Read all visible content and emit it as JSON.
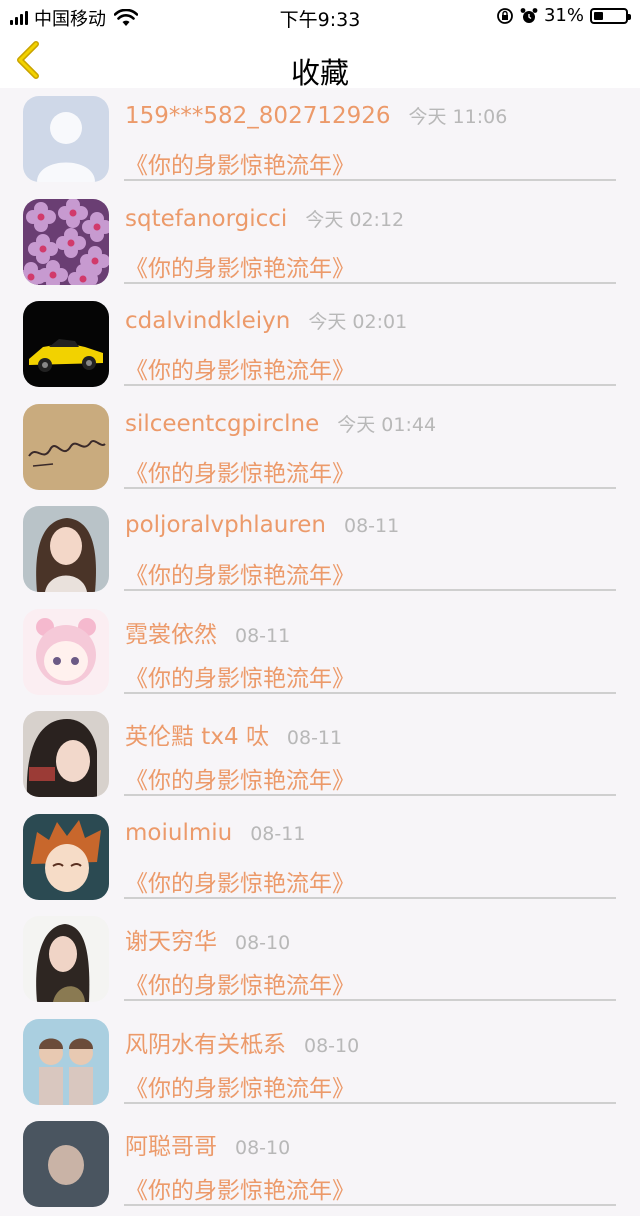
{
  "status_bar": {
    "carrier": "中国移动",
    "time": "下午9:33",
    "battery": "31%",
    "battery_level": 0.31
  },
  "nav": {
    "title": "收藏",
    "back_icon": "chevron-left-icon",
    "back_color": "#e6b800"
  },
  "items": [
    {
      "name": "159***582_802712926",
      "time": "今天 11:06",
      "song": "《你的身影惊艳流年》"
    },
    {
      "name": "sqtefanorgicci",
      "time": "今天 02:12",
      "song": "《你的身影惊艳流年》"
    },
    {
      "name": "cdalvindkleiyn",
      "time": "今天 02:01",
      "song": "《你的身影惊艳流年》"
    },
    {
      "name": "silceentcgpirclne",
      "time": "今天 01:44",
      "song": "《你的身影惊艳流年》"
    },
    {
      "name": "poljoralvphlauren",
      "time": "08-11",
      "song": "《你的身影惊艳流年》"
    },
    {
      "name": "霓裳依然",
      "time": "08-11",
      "song": "《你的身影惊艳流年》"
    },
    {
      "name": "英伦黠 tx4 呔",
      "time": "08-11",
      "song": "《你的身影惊艳流年》"
    },
    {
      "name": "moiulmiu",
      "time": "08-11",
      "song": "《你的身影惊艳流年》"
    },
    {
      "name": "谢天穷华",
      "time": "08-10",
      "song": "《你的身影惊艳流年》"
    },
    {
      "name": "风阴水有关柢系",
      "time": "08-10",
      "song": "《你的身影惊艳流年》"
    },
    {
      "name": "阿聪哥哥",
      "time": "08-10",
      "song": "《你的身影惊艳流年》"
    }
  ],
  "colors": {
    "accent": "#ec9a6a",
    "time": "#b8b8b8",
    "divider": "#cfcfcf"
  }
}
